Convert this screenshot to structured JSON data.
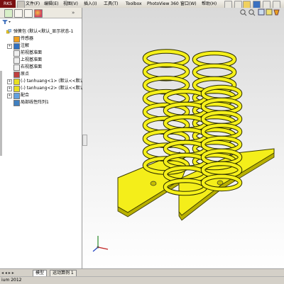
{
  "app": {
    "brand": "RKS",
    "status_text": "ium 2012"
  },
  "menu": {
    "items": [
      "文件(F)",
      "编辑(E)",
      "视图(V)",
      "插入(I)",
      "工具(T)",
      "Toolbox",
      "PhotoView 360",
      "窗口(W)",
      "帮助(H)"
    ]
  },
  "tree": {
    "root": "弹簧包 (默认<默认_显示状态-1",
    "items": [
      {
        "label": "传感器",
        "icon": "sensor-icon",
        "expandable": false
      },
      {
        "label": "注解",
        "icon": "annotation-icon",
        "expandable": true
      },
      {
        "label": "前视基准面",
        "icon": "plane-icon",
        "expandable": false
      },
      {
        "label": "上视基准面",
        "icon": "plane-icon",
        "expandable": false
      },
      {
        "label": "右视基准面",
        "icon": "plane-icon",
        "expandable": false
      },
      {
        "label": "原点",
        "icon": "origin-icon",
        "expandable": false
      },
      {
        "label": "(-) tanhuang<1> (默认<<默认>_显",
        "icon": "part-icon",
        "expandable": true
      },
      {
        "label": "(-) tanhuang<2> (默认<<默认>_显",
        "icon": "part-icon",
        "expandable": true
      },
      {
        "label": "配合",
        "icon": "mates-icon",
        "expandable": true
      },
      {
        "label": "局部线性阵列1",
        "icon": "pattern-icon",
        "expandable": false
      }
    ]
  },
  "bottom_tabs": [
    "模型",
    "运动算例 1"
  ],
  "colors": {
    "spring": "#f5f01a",
    "spring_edge": "#2a2a00",
    "brand": "#7a1010"
  }
}
